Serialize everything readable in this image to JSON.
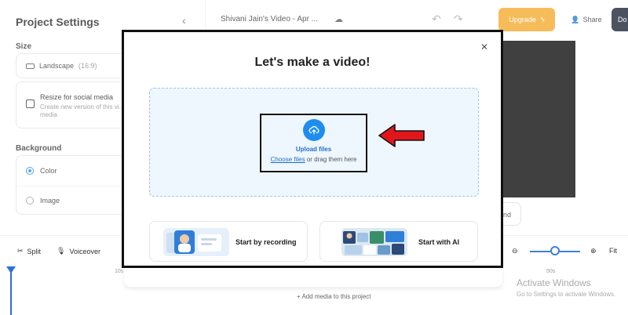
{
  "left_panel": {
    "title": "Project Settings",
    "collapse_icon": "chevron-left-icon",
    "size_label": "Size",
    "size_option": "Landscape",
    "size_ratio": "(16:9)",
    "resize_title": "Resize for social media",
    "resize_subtitle": "Create new version of this vi... media",
    "background_label": "Background",
    "bg_options": [
      {
        "label": "Color",
        "selected": true
      },
      {
        "label": "Image",
        "selected": false
      }
    ]
  },
  "topbar": {
    "doc_title": "Shivani Jain's Video - Apr ...",
    "upgrade_label": "Upgrade",
    "share_label": "Share",
    "download_label": "Do"
  },
  "canvas": {
    "stray_text": "nd"
  },
  "toolbar": {
    "split_label": "Split",
    "voiceover_label": "Voiceover",
    "fit_label": "Fit"
  },
  "timeline": {
    "ruler": [
      "10s",
      "50s"
    ],
    "add_media": "+ Add media to this project"
  },
  "watermark": {
    "title": "Activate Windows",
    "subtitle": "Go to Settings to activate Windows."
  },
  "modal": {
    "title": "Let's make a video!",
    "upload_label": "Upload files",
    "choose_link": "Choose files",
    "drag_text": " or drag them here",
    "option_recording": "Start by recording",
    "option_ai": "Start with AI"
  },
  "colors": {
    "accent": "#1e8df0",
    "upgrade": "#f5a623",
    "arrow": "#e0161b",
    "download": "#10182b"
  }
}
